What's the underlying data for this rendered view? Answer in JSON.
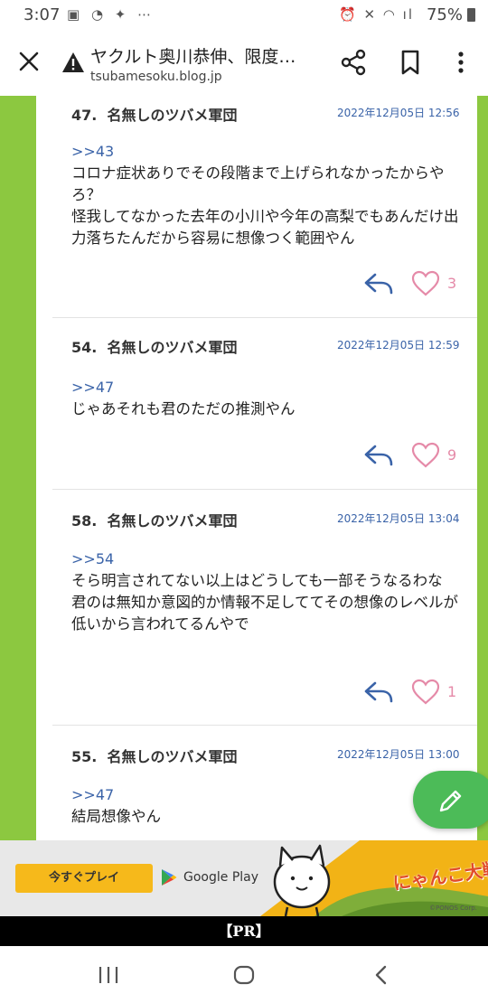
{
  "status_bar": {
    "time": "3:07",
    "battery": "75%"
  },
  "toolbar": {
    "title": "ヤクルト奥川恭伸、限度…",
    "url": "tsubamesoku.blog.jp"
  },
  "comments": [
    {
      "num": "47.",
      "name": "名無しのツバメ軍団",
      "date": "2022年12月05日 12:56",
      "anchor": ">>43",
      "body": "コロナ症状ありでその段階まで上げられなかったからやろ？\n怪我してなかった去年の小川や今年の高梨でもあんだけ出力落ちたんだから容易に想像つく範囲やん",
      "likes": "3"
    },
    {
      "num": "54.",
      "name": "名無しのツバメ軍団",
      "date": "2022年12月05日 12:59",
      "anchor": ">>47",
      "body": "じゃあそれも君のただの推測やん",
      "likes": "9"
    },
    {
      "num": "58.",
      "name": "名無しのツバメ軍団",
      "date": "2022年12月05日 13:04",
      "anchor": ">>54",
      "body": "そら明言されてない以上はどうしても一部そうなるわな\n君のは無知か意図的か情報不足しててその想像のレベルが低いから言われてるんやで",
      "likes": "1"
    },
    {
      "num": "55.",
      "name": "名無しのツバメ軍団",
      "date": "2022年12月05日 13:00",
      "anchor": ">>47",
      "body": "結局想像やん",
      "likes": ""
    }
  ],
  "ad": {
    "button": "今すぐプレイ",
    "store": "Google Play",
    "game_title": "にゃんこ大戦争",
    "copyright": "©PONOS Corp."
  },
  "pr_label": "【PR】",
  "colors": {
    "rail": "#8cc840",
    "link": "#3a63a8",
    "heart": "#e58aa8",
    "fab": "#4cbb58",
    "ad_button": "#f6b91b"
  }
}
